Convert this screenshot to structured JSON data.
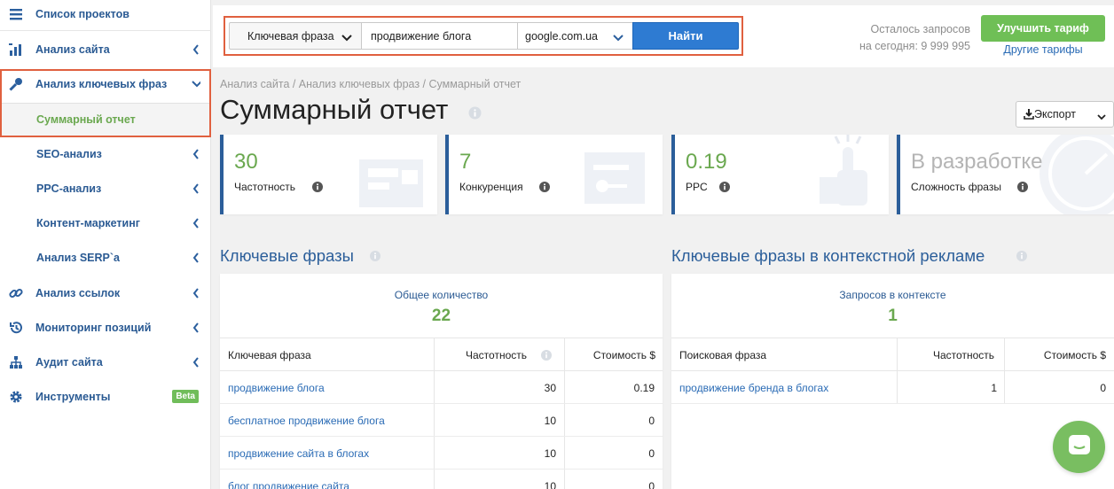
{
  "sidebar": {
    "items": [
      {
        "label": "Список проектов",
        "icon": "list-icon"
      },
      {
        "label": "Анализ сайта",
        "icon": "chart-bars-icon"
      },
      {
        "label": "Анализ ключевых фраз",
        "icon": "key-icon"
      },
      {
        "label": "Суммарный отчет"
      },
      {
        "label": "SEO-анализ"
      },
      {
        "label": "PPC-анализ"
      },
      {
        "label": "Контент-маркетинг"
      },
      {
        "label": "Анализ SERP`a"
      },
      {
        "label": "Анализ ссылок",
        "icon": "link-icon"
      },
      {
        "label": "Мониторинг позиций",
        "icon": "history-icon"
      },
      {
        "label": "Аудит сайта",
        "icon": "sitemap-icon"
      },
      {
        "label": "Инструменты",
        "icon": "gear-icon",
        "badge": "Beta"
      }
    ]
  },
  "search": {
    "mode": "Ключевая фраза",
    "query": "продвижение блога",
    "domain": "google.com.ua",
    "button": "Найти"
  },
  "quota": {
    "line1": "Осталось запросов",
    "line2": "на сегодня: 9 999 995",
    "upgrade": "Улучшить тариф",
    "plans": "Другие тарифы"
  },
  "breadcrumb": "Анализ сайта / Анализ ключевых фраз / Суммарный отчет",
  "page_title": "Суммарный отчет",
  "export_label": "Экспорт",
  "cards": [
    {
      "value": "30",
      "label": "Частотность"
    },
    {
      "value": "7",
      "label": "Конкуренция"
    },
    {
      "value": "0.19",
      "label": "PPC"
    },
    {
      "value": "В разработке",
      "label": "Сложность фразы"
    }
  ],
  "keywords": {
    "title": "Ключевые фразы",
    "total_label": "Общее количество",
    "total_value": "22",
    "headers": [
      "Ключевая фраза",
      "Частотность",
      "Стоимость $"
    ],
    "rows": [
      [
        "продвижение блога",
        "30",
        "0.19"
      ],
      [
        "бесплатное продвижение блога",
        "10",
        "0"
      ],
      [
        "продвижение сайта в блогах",
        "10",
        "0"
      ],
      [
        "блог продвижение сайта",
        "10",
        "0"
      ]
    ]
  },
  "ppc": {
    "title": "Ключевые фразы в контекстной рекламе",
    "total_label": "Запросов в контексте",
    "total_value": "1",
    "headers": [
      "Поисковая фраза",
      "Частотность",
      "Стоимость $"
    ],
    "rows": [
      [
        "продвижение бренда в блогах",
        "1",
        "0"
      ]
    ]
  },
  "colors": {
    "accent_blue": "#2b5e9a",
    "green": "#6fbf56",
    "highlight": "#e0603f"
  }
}
